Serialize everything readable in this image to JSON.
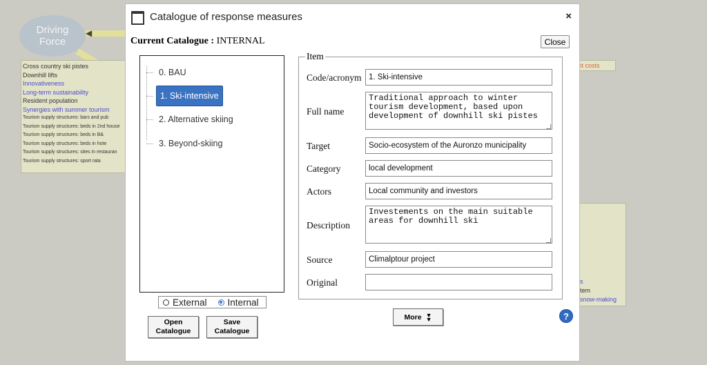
{
  "background": {
    "oval": {
      "line1": "Driving",
      "line2": "Force"
    },
    "list_items": [
      {
        "text": "Cross country ski pistes",
        "style": "fs9"
      },
      {
        "text": "Downhill lifts",
        "style": "fs9"
      },
      {
        "text": "Innovativeness",
        "style": "fs9 blue"
      },
      {
        "text": "Long-term sustainability",
        "style": "fs9 blue"
      },
      {
        "text": "Resident population",
        "style": "fs9"
      },
      {
        "text": "Synergies with summer tourism",
        "style": "fs9 blue"
      },
      {
        "text": "Tourism supply structures: bars and pub",
        "style": "fs7"
      },
      {
        "text": "Tourism supply structures: beds in 2nd house",
        "style": "fs7"
      },
      {
        "text": "Tourism supply structures: beds in B&",
        "style": "fs7"
      },
      {
        "text": "Tourism supply structures: beds in hote",
        "style": "fs7"
      },
      {
        "text": "Tourism supply structures: sites in restauran",
        "style": "fs7"
      },
      {
        "text": "Tourism supply structures: sport rata",
        "style": "fs7"
      }
    ],
    "right_tag": "ment costs",
    "right_box": {
      "line1": "s",
      "line2": "tem",
      "line3": "snow-making"
    }
  },
  "dialog": {
    "title": "Catalogue of response measures",
    "close_x": "×",
    "current_catalogue_label": "Current Catalogue :",
    "current_catalogue_value": "INTERNAL",
    "close_button": "Close",
    "tree": [
      {
        "label": "0. BAU",
        "selected": false
      },
      {
        "label": "1. Ski-intensive",
        "selected": true
      },
      {
        "label": "2. Alternative skiing",
        "selected": false
      },
      {
        "label": "3. Beyond-skiing",
        "selected": false
      }
    ],
    "radio": {
      "external": "External",
      "internal": "Internal",
      "selected": "internal"
    },
    "open_catalogue": [
      "Open",
      "Catalogue"
    ],
    "save_catalogue": [
      "Save",
      "Catalogue"
    ],
    "item": {
      "legend": "Item",
      "code_label": "Code/acronym",
      "code_value": "1. Ski-intensive",
      "fullname_label": "Full name",
      "fullname_value": "Traditional approach to winter tourism development, based upon development of downhill ski pistes",
      "target_label": "Target",
      "target_value": "Socio-ecosystem of the Auronzo municipality",
      "category_label": "Category",
      "category_value": "local development",
      "actors_label": "Actors",
      "actors_value": "Local community and investors",
      "description_label": "Description",
      "description_value": "Investements on the main suitable areas for downhill ski",
      "source_label": "Source",
      "source_value": "Climalptour project",
      "original_label": "Original",
      "original_value": ""
    },
    "more_button": "More",
    "help": "?"
  }
}
